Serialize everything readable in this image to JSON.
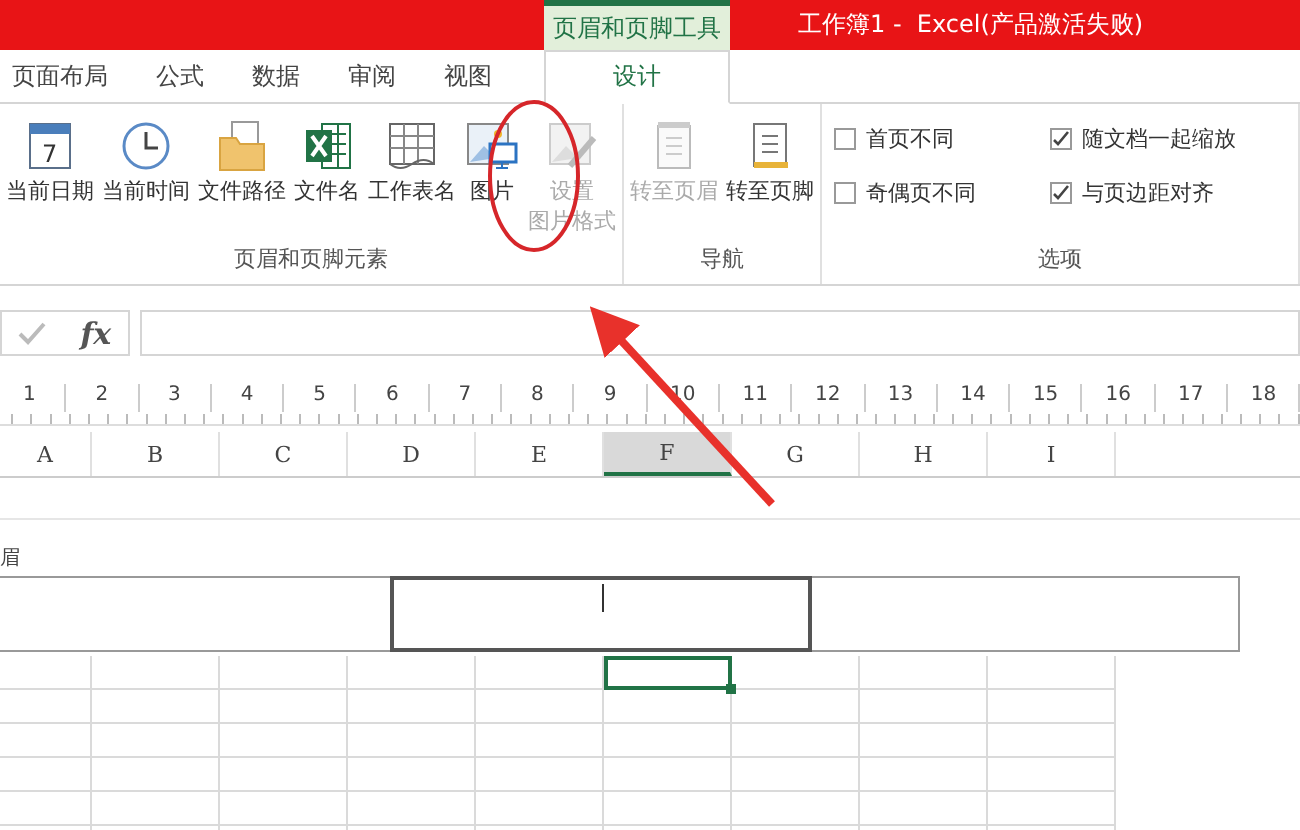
{
  "window": {
    "context_tab_group": "页眉和页脚工具",
    "title": "工作簿1 -  Excel(产品激活失败)"
  },
  "tabs": [
    {
      "label": "页面布局",
      "selected": false
    },
    {
      "label": "公式",
      "selected": false
    },
    {
      "label": "数据",
      "selected": false
    },
    {
      "label": "审阅",
      "selected": false
    },
    {
      "label": "视图",
      "selected": false
    },
    {
      "label": "设计",
      "selected": true
    }
  ],
  "ribbon": {
    "groups": [
      {
        "label": "页眉和页脚元素",
        "kind": "buttons",
        "buttons": [
          {
            "kind": "date",
            "label": "当前日期",
            "icon_text": "7",
            "disabled": false
          },
          {
            "kind": "time",
            "label": "当前时间",
            "disabled": false
          },
          {
            "kind": "folder",
            "label": "文件路径",
            "disabled": false
          },
          {
            "kind": "excel",
            "label": "文件名",
            "disabled": false
          },
          {
            "kind": "sheet",
            "label": "工作表名",
            "disabled": false
          },
          {
            "kind": "picture",
            "label": "图片",
            "disabled": false
          },
          {
            "kind": "format",
            "label": [
              "设置",
              "图片格式"
            ],
            "disabled": true
          }
        ]
      },
      {
        "label": "导航",
        "kind": "buttons",
        "buttons": [
          {
            "kind": "header",
            "label": "转至页眉",
            "disabled": true
          },
          {
            "kind": "footer",
            "label": "转至页脚",
            "disabled": false
          }
        ]
      },
      {
        "label": "选项",
        "kind": "checks",
        "checks": [
          {
            "label": "首页不同",
            "checked": false
          },
          {
            "label": "随文档一起缩放",
            "checked": true
          },
          {
            "label": "奇偶页不同",
            "checked": false
          },
          {
            "label": "与页边距对齐",
            "checked": true
          }
        ]
      }
    ]
  },
  "formula_bar": {
    "fx": "fx"
  },
  "ruler": [
    "1",
    "2",
    "3",
    "4",
    "5",
    "6",
    "7",
    "8",
    "9",
    "10",
    "11",
    "12",
    "13",
    "14",
    "15",
    "16",
    "17",
    "18"
  ],
  "columns": [
    {
      "label": "A",
      "selected": false
    },
    {
      "label": "B",
      "selected": false
    },
    {
      "label": "C",
      "selected": false
    },
    {
      "label": "D",
      "selected": false
    },
    {
      "label": "E",
      "selected": false
    },
    {
      "label": "F",
      "selected": true
    },
    {
      "label": "G",
      "selected": false
    },
    {
      "label": "H",
      "selected": false
    },
    {
      "label": "I",
      "selected": false
    }
  ],
  "header_area": {
    "label": "眉",
    "sections": [
      {
        "selected": false
      },
      {
        "selected": true
      },
      {
        "selected": false
      }
    ]
  }
}
